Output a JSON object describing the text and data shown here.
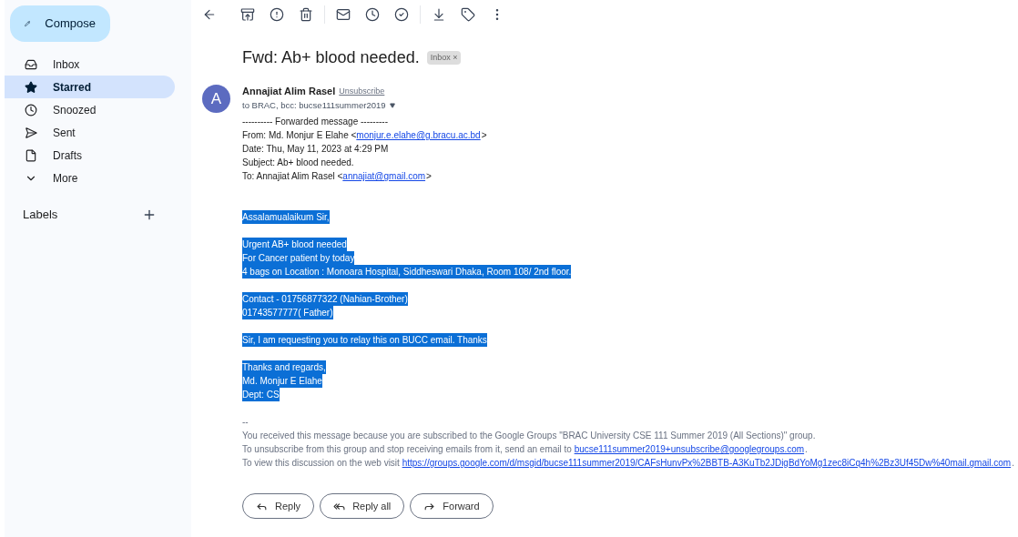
{
  "sidebar": {
    "compose": "Compose",
    "items": [
      {
        "label": "Inbox",
        "selected": false
      },
      {
        "label": "Starred",
        "selected": true
      },
      {
        "label": "Snoozed",
        "selected": false
      },
      {
        "label": "Sent",
        "selected": false
      },
      {
        "label": "Drafts",
        "selected": false
      },
      {
        "label": "More",
        "selected": false
      }
    ],
    "labels_heading": "Labels"
  },
  "email": {
    "subject": "Fwd: Ab+ blood needed.",
    "label_chip": {
      "text": "Inbox",
      "close": "×"
    },
    "sender": {
      "avatar": "A",
      "name": "Annajiat Alim Rasel",
      "unsubscribe": "Unsubscribe",
      "recipients": "to BRAC, bcc: bucse111summer2019"
    },
    "forward_header": [
      {
        "text": "---------- Forwarded message ---------"
      },
      {
        "text": "From: Md. Monjur E Elahe <",
        "link": "monjur.e.elahe@g.bracu.ac.bd",
        "after": ">"
      },
      {
        "text": "Date: Thu, May 11, 2023 at 4:29 PM"
      },
      {
        "text": "Subject: Ab+ blood needed."
      },
      {
        "text": "To: Annajiat Alim Rasel <",
        "link": "annajiat@gmail.com",
        "after": ">"
      }
    ],
    "body": {
      "selected": true,
      "paragraphs": [
        [
          "Assalamualaikum Sir,"
        ],
        [
          "Urgent AB+ blood needed",
          "For Cancer patient by today",
          "4 bags on Location : Monoara Hospital, Siddheswari Dhaka, Room 108/ 2nd floor."
        ],
        [
          "Contact - 01756877322 (Nahian-Brother)",
          "01743577777( Father)"
        ],
        [
          "Sir, I am requesting you to relay this on BUCC email. Thanks"
        ],
        [
          "Thanks and regards,",
          "Md. Monjur E Elahe",
          "Dept: CS"
        ]
      ]
    },
    "footer": [
      {
        "text": "--"
      },
      {
        "text": "You received this message because you are subscribed to the Google Groups \"BRAC University CSE 111 Summer 2019 (All Sections)\" group."
      },
      {
        "text": "To unsubscribe from this group and stop receiving emails from it, send an email to ",
        "link": "bucse111summer2019+unsubscribe@googlegroups.com",
        "after": "."
      },
      {
        "text": "To view this discussion on the web visit ",
        "link": "https://groups.google.com/d/msgid/bucse111summer2019/CAFsHunvPx%2BBTB-A3KuTb2JDigBdYoMg1zec8iCq4h%2Bz3Uf45Dw%40mail.gmail.com",
        "after": "."
      }
    ],
    "actions": [
      {
        "label": "Reply"
      },
      {
        "label": "Reply all"
      },
      {
        "label": "Forward"
      }
    ]
  }
}
